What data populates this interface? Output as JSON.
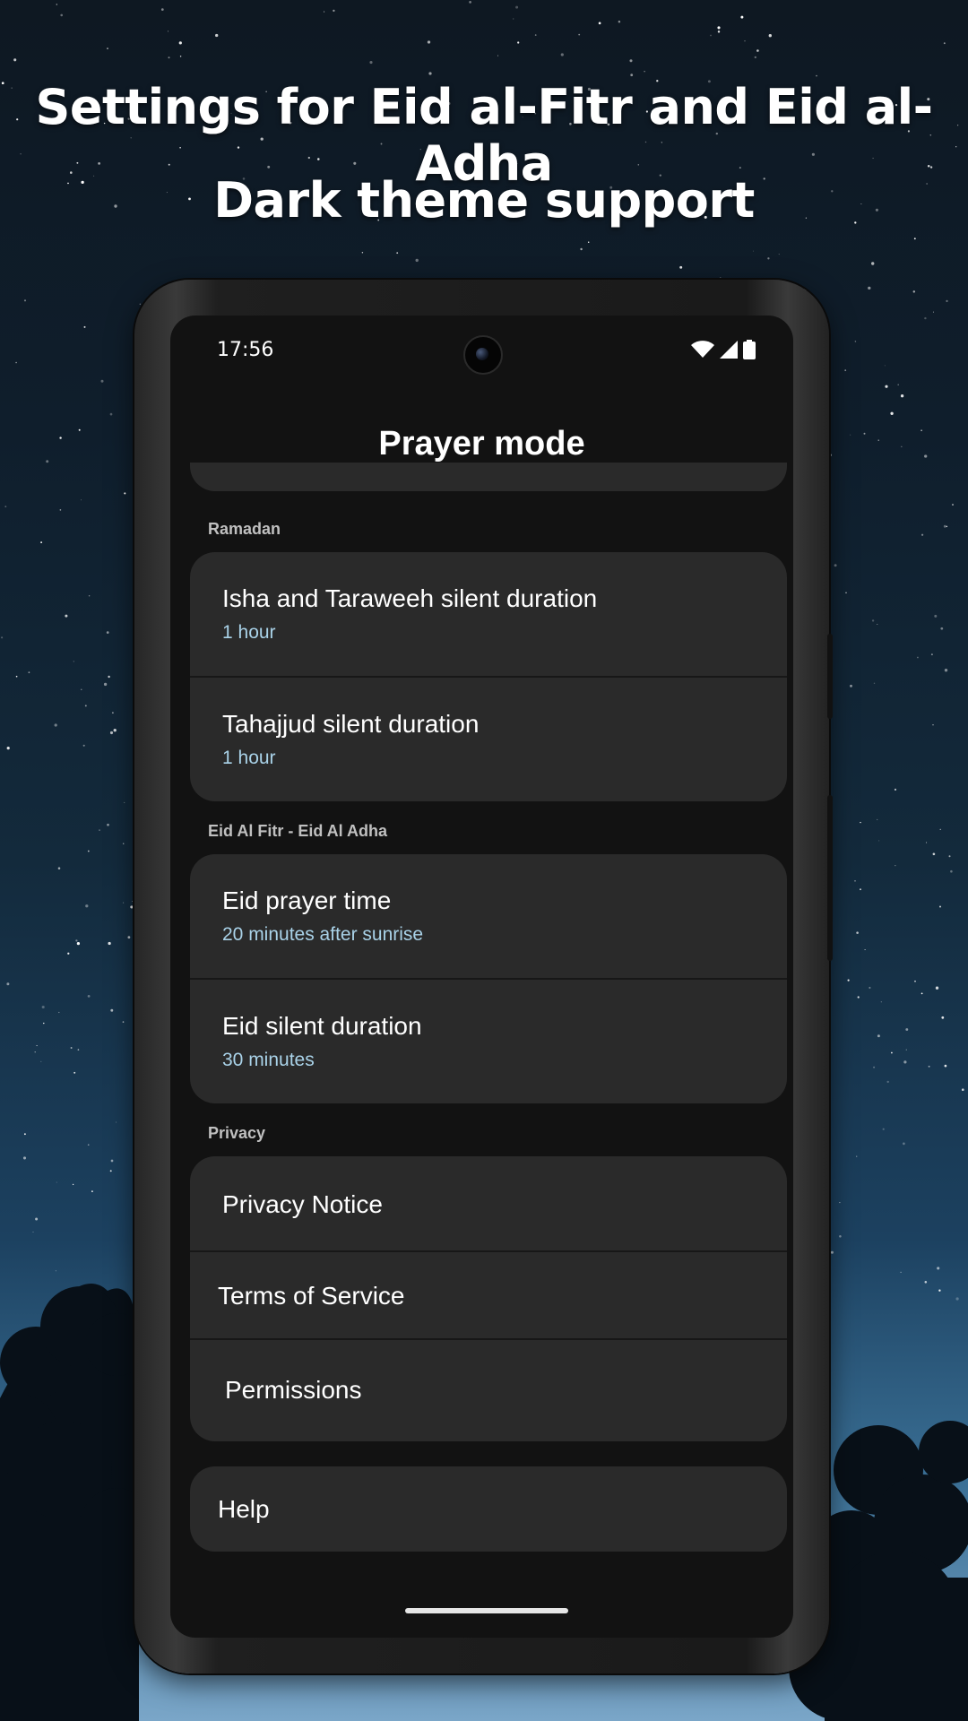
{
  "promo": {
    "headline_line1": "Settings for Eid al-Fitr and Eid al-Adha",
    "headline_line2": "Dark theme support"
  },
  "status_bar": {
    "time": "17:56",
    "icons": [
      "wifi-icon",
      "cellular-signal-icon",
      "battery-icon"
    ]
  },
  "app_bar": {
    "title": "Prayer mode"
  },
  "sections": {
    "ramadan": {
      "header": "Ramadan",
      "items": [
        {
          "title": "Isha and Taraweeh silent duration",
          "subtitle": "1 hour"
        },
        {
          "title": "Tahajjud silent duration",
          "subtitle": "1 hour"
        }
      ]
    },
    "eid": {
      "header": "Eid Al Fitr - Eid Al Adha",
      "items": [
        {
          "title": "Eid prayer time",
          "subtitle": "20 minutes after sunrise"
        },
        {
          "title": "Eid silent duration",
          "subtitle": "30 minutes"
        }
      ]
    },
    "privacy": {
      "header": "Privacy",
      "items": [
        {
          "title": "Privacy Notice"
        },
        {
          "title": "Terms of Service"
        },
        {
          "title": "Permissions"
        }
      ]
    },
    "help": {
      "items": [
        {
          "title": "Help"
        }
      ]
    }
  },
  "colors": {
    "screen_background": "#121212",
    "card_background": "#2a2a2a",
    "subtitle_accent": "#a9d2e8",
    "section_header": "#c0c0c0"
  }
}
